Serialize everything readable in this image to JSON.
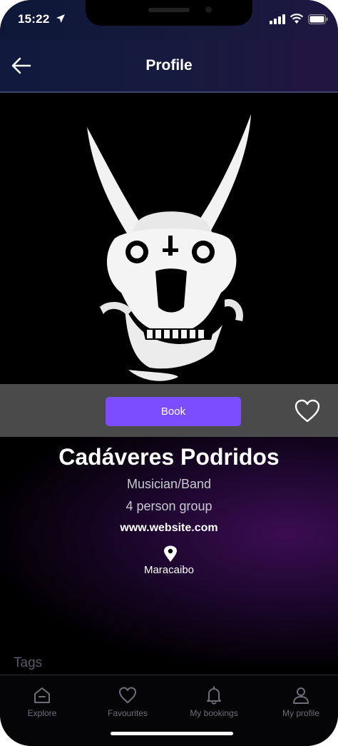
{
  "status_bar": {
    "time": "15:22"
  },
  "header": {
    "title": "Profile"
  },
  "actions": {
    "book_label": "Book"
  },
  "profile": {
    "name": "Cadáveres Podridos",
    "category": "Musician/Band",
    "group_size": "4 person group",
    "website": "www.website.com",
    "location": "Maracaibo"
  },
  "sections": {
    "tags_heading": "Tags"
  },
  "tab_bar": {
    "items": [
      {
        "label": "Explore",
        "icon": "home-icon"
      },
      {
        "label": "Favourites",
        "icon": "heart-icon"
      },
      {
        "label": "My bookings",
        "icon": "bell-icon"
      },
      {
        "label": "My profile",
        "icon": "user-icon"
      }
    ]
  },
  "colors": {
    "accent": "#7c4dff",
    "header_bg": "#131a3e",
    "strip_bg": "#4a4a4a"
  }
}
